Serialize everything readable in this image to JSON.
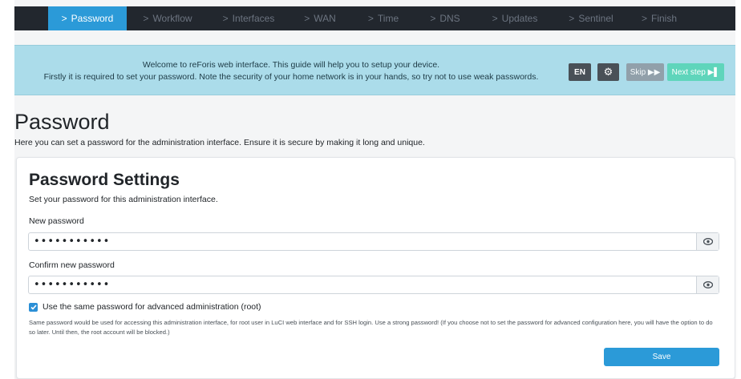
{
  "nav": {
    "steps": [
      {
        "label": "Password",
        "active": true
      },
      {
        "label": "Workflow"
      },
      {
        "label": "Interfaces"
      },
      {
        "label": "WAN"
      },
      {
        "label": "Time"
      },
      {
        "label": "DNS"
      },
      {
        "label": "Updates"
      },
      {
        "label": "Sentinel"
      },
      {
        "label": "Finish"
      }
    ]
  },
  "banner": {
    "line1": "Welcome to reForis web interface. This guide will help you to setup your device.",
    "line2": "Firstly it is required to set your password. Note the security of your home network is in your hands, so try not to use weak passwords.",
    "lang_label": "EN",
    "skip_label": "Skip ▶▶",
    "next_label": "Next step ▶▌"
  },
  "page": {
    "title": "Password",
    "description": "Here you can set a password for the administration interface. Ensure it is secure by making it long and unique."
  },
  "card": {
    "title": "Password Settings",
    "subtitle": "Set your password for this administration interface.",
    "new_password_label": "New password",
    "new_password_value": "•••••••••••",
    "confirm_label": "Confirm new password",
    "confirm_value": "•••••••••••",
    "same_password_label": "Use the same password for advanced administration (root)",
    "same_password_checked": true,
    "help_text": "Same password would be used for accessing this administration interface, for root user in LuCI web interface and for SSH login. Use a strong password! (If you choose not to set the password for advanced configuration here, you will have the option to do so later. Until then, the root account will be blocked.)",
    "save_label": "Save"
  },
  "icons": {
    "settings": "gear-icon",
    "show_password": "eye-icon",
    "nav_step": "chevron-right-icon"
  },
  "colors": {
    "accent": "#2b9ad8",
    "nav_bg": "#22272e",
    "banner_bg": "#abdcea",
    "next_step": "#5fd5bb"
  }
}
